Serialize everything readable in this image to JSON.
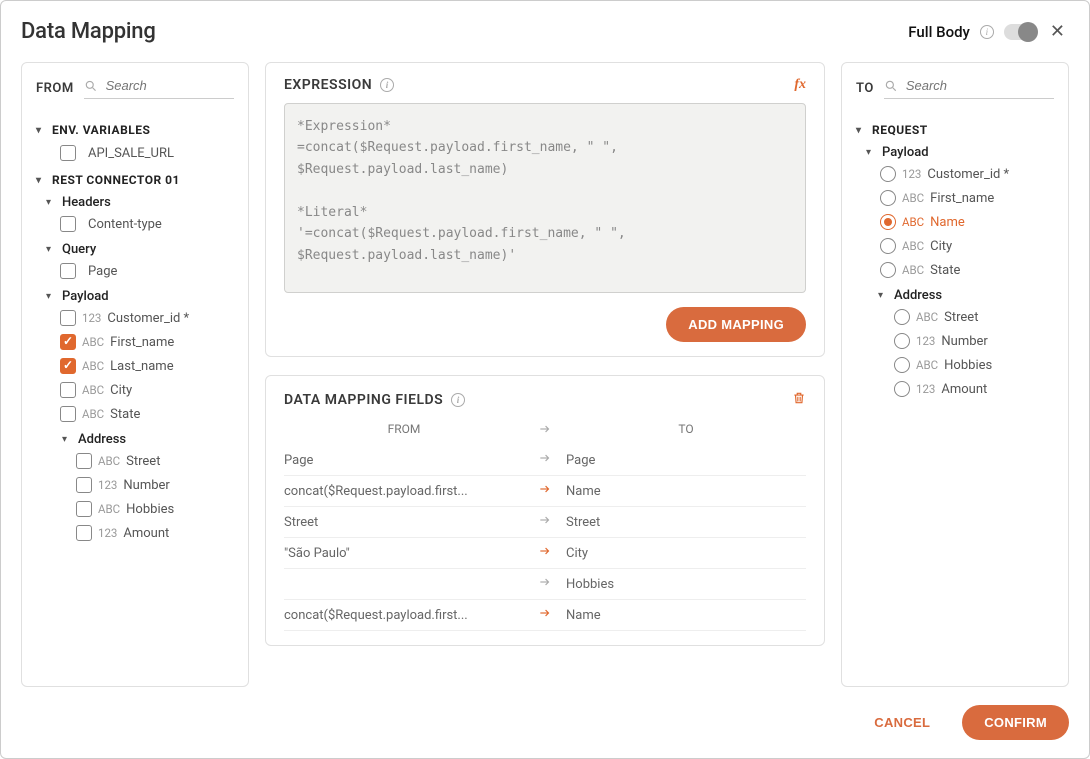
{
  "title": "Data Mapping",
  "fullBody": {
    "label": "Full Body",
    "on": false
  },
  "from": {
    "label": "FROM",
    "searchPlaceholder": "Search",
    "sections": [
      {
        "label": "ENV. VARIABLES",
        "items": [
          {
            "type": "",
            "label": "API_SALE_URL",
            "checked": false
          }
        ]
      },
      {
        "label": "REST CONNECTOR 01",
        "groups": [
          {
            "label": "Headers",
            "items": [
              {
                "type": "",
                "label": "Content-type",
                "checked": false
              }
            ]
          },
          {
            "label": "Query",
            "items": [
              {
                "type": "",
                "label": "Page",
                "checked": false
              }
            ]
          },
          {
            "label": "Payload",
            "items": [
              {
                "type": "123",
                "label": "Customer_id *",
                "checked": false
              },
              {
                "type": "ABC",
                "label": "First_name",
                "checked": true
              },
              {
                "type": "ABC",
                "label": "Last_name",
                "checked": true
              },
              {
                "type": "ABC",
                "label": "City",
                "checked": false
              },
              {
                "type": "ABC",
                "label": "State",
                "checked": false
              }
            ],
            "groups": [
              {
                "label": "Address",
                "items": [
                  {
                    "type": "ABC",
                    "label": "Street",
                    "checked": false
                  },
                  {
                    "type": "123",
                    "label": "Number",
                    "checked": false
                  },
                  {
                    "type": "ABC",
                    "label": "Hobbies",
                    "checked": false
                  },
                  {
                    "type": "123",
                    "label": "Amount",
                    "checked": false
                  }
                ]
              }
            ]
          }
        ]
      }
    ]
  },
  "expression": {
    "label": "EXPRESSION",
    "code": "*Expression*\n=concat($Request.payload.first_name, \" \",\n$Request.payload.last_name)\n\n*Literal*\n'=concat($Request.payload.first_name, \" \",\n$Request.payload.last_name)'",
    "addBtn": "ADD MAPPING"
  },
  "mappingFields": {
    "label": "DATA MAPPING FIELDS",
    "head": {
      "from": "FROM",
      "to": "TO"
    },
    "rows": [
      {
        "from": "Page",
        "to": "Page",
        "active": false
      },
      {
        "from": "concat($Request.payload.first...",
        "to": "Name",
        "active": true
      },
      {
        "from": "Street",
        "to": "Street",
        "active": false
      },
      {
        "from": "\"São Paulo\"",
        "to": "City",
        "active": true
      },
      {
        "from": "",
        "to": "Hobbies",
        "active": false
      },
      {
        "from": "concat($Request.payload.first...",
        "to": "Name",
        "active": true
      }
    ]
  },
  "to": {
    "label": "TO",
    "searchPlaceholder": "Search",
    "section": {
      "label": "REQUEST",
      "groups": [
        {
          "label": "Payload",
          "items": [
            {
              "type": "123",
              "label": "Customer_id *",
              "selected": false
            },
            {
              "type": "ABC",
              "label": "First_name",
              "selected": false
            },
            {
              "type": "ABC",
              "label": "Name",
              "selected": true
            },
            {
              "type": "ABC",
              "label": "City",
              "selected": false
            },
            {
              "type": "ABC",
              "label": "State",
              "selected": false
            }
          ]
        },
        {
          "label": "Address",
          "items": [
            {
              "type": "ABC",
              "label": "Street",
              "selected": false
            },
            {
              "type": "123",
              "label": "Number",
              "selected": false
            },
            {
              "type": "ABC",
              "label": "Hobbies",
              "selected": false
            },
            {
              "type": "123",
              "label": "Amount",
              "selected": false
            }
          ]
        }
      ]
    }
  },
  "footer": {
    "cancel": "CANCEL",
    "confirm": "CONFIRM"
  }
}
